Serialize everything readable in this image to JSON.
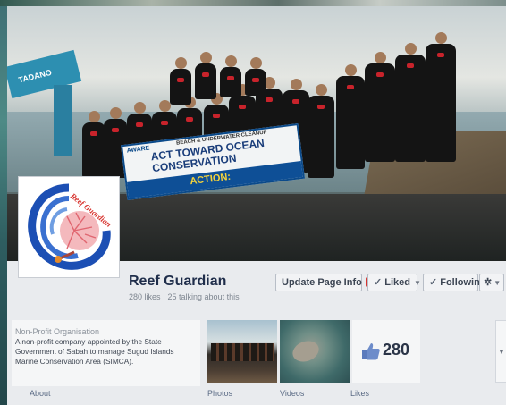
{
  "page": {
    "name": "Reef Guardian",
    "stats": "280 likes · 25 talking about this"
  },
  "cover": {
    "banner_small": "BEACH & UNDERWATER CLEANUP",
    "banner_main": "ACT TOWARD OCEAN CONSERVATION",
    "banner_action": "ACTION:",
    "banner_logo": "AWARE",
    "crane_label": "TADANO"
  },
  "profile_logo_text": "Reef Guardian",
  "actions": {
    "update_info": "Update Page Info",
    "update_badge": "1",
    "liked": "Liked",
    "following": "Following"
  },
  "about": {
    "category": "Non-Profit Organisation",
    "description": "A non-profit company appointed by the State Government of Sabah to manage Sugud Islands Marine Conservation Area (SIMCA).",
    "label": "About"
  },
  "tiles": {
    "photos": "Photos",
    "videos": "Videos",
    "likes_label": "Likes",
    "likes_count": "280"
  },
  "colors": {
    "accent": "#3b5998",
    "badge": "#d8342f"
  }
}
